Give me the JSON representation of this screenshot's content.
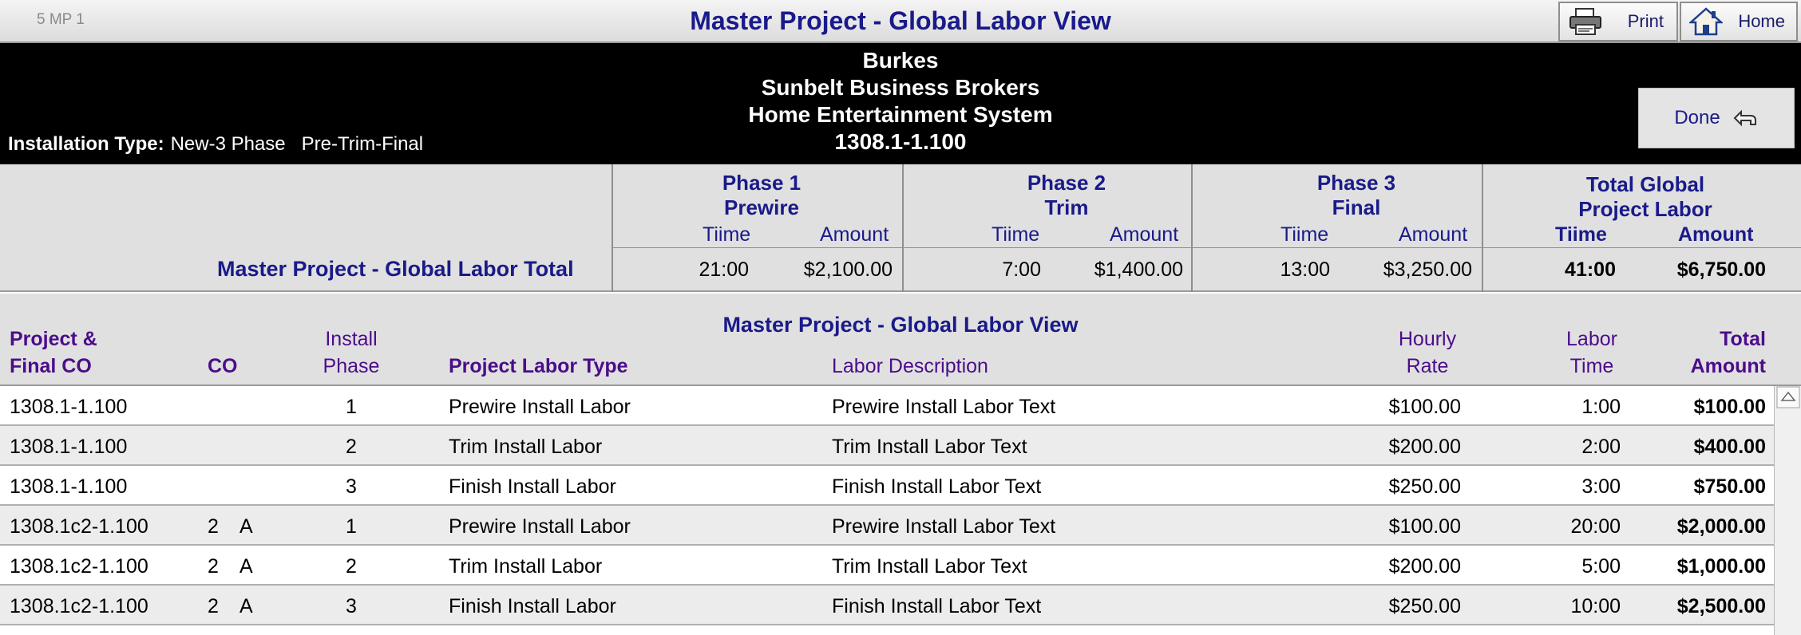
{
  "window": {
    "record_label": "5  MP 1",
    "title": "Master Project - Global Labor View",
    "print_label": "Print",
    "home_label": "Home",
    "icons": {
      "print": "printer-icon",
      "home": "house-icon",
      "done": "return-arrow-icon",
      "scroll_up": "scroll-up-arrow-icon"
    }
  },
  "header": {
    "client": "Burkes",
    "company": "Sunbelt Business Brokers",
    "system": "Home Entertainment System",
    "project_number": "1308.1-1.100",
    "installation_type_label": "Installation Type:",
    "installation_type_value": "New-3 Phase   Pre-Trim-Final",
    "done_label": "Done"
  },
  "summary": {
    "phases": [
      {
        "line1": "Phase 1",
        "line2": "Prewire",
        "time_label": "Tiime",
        "amount_label": "Amount",
        "time": "21:00",
        "amount": "$2,100.00"
      },
      {
        "line1": "Phase 2",
        "line2": "Trim",
        "time_label": "Tiime",
        "amount_label": "Amount",
        "time": "7:00",
        "amount": "$1,400.00"
      },
      {
        "line1": "Phase 3",
        "line2": "Final",
        "time_label": "Tiime",
        "amount_label": "Amount",
        "time": "13:00",
        "amount": "$3,250.00"
      }
    ],
    "total": {
      "line1": "Total Global",
      "line2": "Project Labor",
      "time_label": "Tiime",
      "amount_label": "Amount",
      "time": "41:00",
      "amount": "$6,750.00"
    },
    "row_label": "Master Project - Global Labor Total"
  },
  "detail": {
    "title": "Master Project - Global Labor View",
    "columns": {
      "project_line1": "Project &",
      "project_line2": "Final CO",
      "co": "CO",
      "phase_line1": "Install",
      "phase_line2": "Phase",
      "labor_type": "Project Labor Type",
      "description": "Labor Description",
      "rate_line1": "Hourly",
      "rate_line2": "Rate",
      "time_line1": "Labor",
      "time_line2": "Time",
      "amount_line1": "Total",
      "amount_line2": "Amount"
    },
    "rows": [
      {
        "project": "1308.1-1.100",
        "co_num": "",
        "co_letter": "",
        "phase": "1",
        "labor_type": "Prewire Install Labor",
        "description": "Prewire Install Labor Text",
        "rate": "$100.00",
        "time": "1:00",
        "amount": "$100.00"
      },
      {
        "project": "1308.1-1.100",
        "co_num": "",
        "co_letter": "",
        "phase": "2",
        "labor_type": "Trim Install Labor",
        "description": "Trim Install Labor Text",
        "rate": "$200.00",
        "time": "2:00",
        "amount": "$400.00"
      },
      {
        "project": "1308.1-1.100",
        "co_num": "",
        "co_letter": "",
        "phase": "3",
        "labor_type": "Finish Install Labor",
        "description": "Finish Install Labor Text",
        "rate": "$250.00",
        "time": "3:00",
        "amount": "$750.00"
      },
      {
        "project": "1308.1c2-1.100",
        "co_num": "2",
        "co_letter": "A",
        "phase": "1",
        "labor_type": "Prewire Install Labor",
        "description": "Prewire Install Labor Text",
        "rate": "$100.00",
        "time": "20:00",
        "amount": "$2,000.00"
      },
      {
        "project": "1308.1c2-1.100",
        "co_num": "2",
        "co_letter": "A",
        "phase": "2",
        "labor_type": "Trim Install Labor",
        "description": "Trim Install Labor Text",
        "rate": "$200.00",
        "time": "5:00",
        "amount": "$1,000.00"
      },
      {
        "project": "1308.1c2-1.100",
        "co_num": "2",
        "co_letter": "A",
        "phase": "3",
        "labor_type": "Finish Install Labor",
        "description": "Finish Install Labor Text",
        "rate": "$250.00",
        "time": "10:00",
        "amount": "$2,500.00"
      }
    ]
  }
}
